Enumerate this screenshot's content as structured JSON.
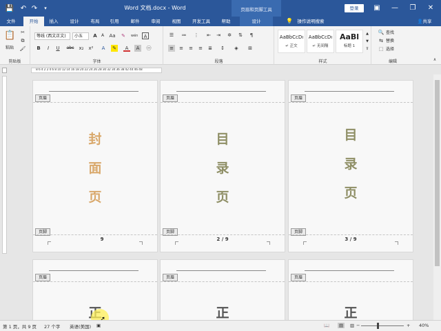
{
  "titlebar": {
    "doc_title": "Word 文档.docx  -  Word",
    "context_title": "页眉和页脚工具",
    "login": "登录",
    "qa_save": "💾",
    "qa_undo": "↶",
    "qa_redo": "↷",
    "minimize": "—",
    "restore": "❐",
    "close": "✕",
    "ribbon_display": "▣"
  },
  "tabs": {
    "file": "文件",
    "home": "开始",
    "insert": "插入",
    "design_main": "设计",
    "layout": "布局",
    "references": "引用",
    "mailings": "邮件",
    "review": "审阅",
    "view": "视图",
    "developer": "开发工具",
    "help": "帮助",
    "hf_design": "设计",
    "tell_me": "操作说明搜索",
    "share": "共享"
  },
  "ribbon": {
    "clipboard": {
      "label": "剪贴板",
      "paste": "粘贴"
    },
    "font": {
      "label": "字体",
      "font_name": "等线 (西文正文)",
      "font_size": "小五",
      "bold": "B",
      "italic": "I",
      "underline": "U",
      "strike": "abc",
      "subscript": "x₂",
      "superscript": "x²",
      "grow": "A",
      "shrink": "A",
      "aa": "Aa",
      "wen": "wén",
      "font_color": "A",
      "char_border": "A",
      "char_shading": "A"
    },
    "paragraph": {
      "label": "段落"
    },
    "styles": {
      "label": "样式",
      "items": [
        {
          "sample": "AaBbCcDı",
          "name": "↵ 正文"
        },
        {
          "sample": "AaBbCcDı",
          "name": "↵ 无间隔"
        },
        {
          "sample": "AaBl",
          "name": "标题 1"
        }
      ]
    },
    "editing": {
      "label": "编辑",
      "find": "查找",
      "replace": "替换",
      "select": "选择"
    }
  },
  "ruler_text": "8 6 4 2   2 4 6 8 10 12 14 16 18 20 22 24 26 28 30 32 34 36 38     42 44 46 48",
  "pages": [
    {
      "header_tag": "页眉",
      "footer_tag": "页脚",
      "chars": [
        "封",
        "面",
        "页"
      ],
      "color": "#d9a86b",
      "page_number": "9",
      "chars_top": [
        70,
        112,
        154
      ]
    },
    {
      "header_tag": "页眉",
      "footer_tag": "页脚",
      "chars": [
        "目",
        "录",
        "页"
      ],
      "color": "#8f8f66",
      "page_number": "2 / 9",
      "chars_top": [
        70,
        112,
        154
      ]
    },
    {
      "header_tag": "页眉",
      "footer_tag": "页脚",
      "chars": [
        "目",
        "录",
        "页"
      ],
      "color": "#8f8f66",
      "page_number": "3 / 9",
      "chars_top": [
        64,
        106,
        148
      ]
    },
    {
      "header_tag": "页眉",
      "chars": [
        "正"
      ],
      "color": "#555555"
    },
    {
      "header_tag": "页眉",
      "chars": [
        "正"
      ],
      "color": "#555555"
    },
    {
      "header_tag": "页眉",
      "chars": [
        "正"
      ],
      "color": "#555555"
    }
  ],
  "status": {
    "page": "第 1 页，共 9 页",
    "words": "27 个字",
    "language": "英语(美国)",
    "zoom": "40%"
  }
}
